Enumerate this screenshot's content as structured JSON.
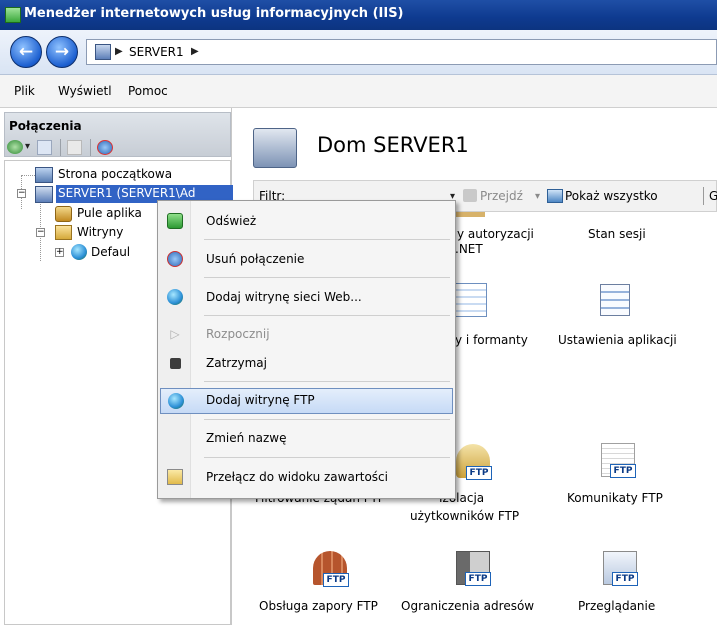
{
  "window": {
    "title": "Menedżer internetowych usług informacyjnych (IIS)"
  },
  "address": {
    "crumb_server": "SERVER1"
  },
  "menu": [
    "Plik",
    "Wyświetl",
    "Pomoc"
  ],
  "connections": {
    "title": "Połączenia",
    "tree": {
      "start_page": "Strona początkowa",
      "server": "SERVER1 (SERVER1\\Ad",
      "app_pools": "Pule aplika",
      "sites": "Witryny",
      "default_site": "Defaul"
    }
  },
  "main": {
    "title": "Dom SERVER1",
    "filter_label": "Filtr:",
    "go_label": "Przejdź",
    "show_all_label": "Pokaż wszystko",
    "group_label": "G",
    "features": {
      "auth_rules": "y autoryzacji",
      "auth_rules_2": ".NET",
      "session_state": "Stan sesji",
      "controls": "y i formanty",
      "app_settings": "Ustawienia aplikacji",
      "ftp_filter": "Filtrowanie żądań FTP",
      "ftp_isolation": "Izolacja",
      "ftp_isolation_2": "użytkowników FTP",
      "ftp_messages": "Komunikaty FTP",
      "ftp_firewall": "Obsługa zapory FTP",
      "ftp_ip": "Ograniczenia adresów",
      "ftp_browse": "Przeglądanie"
    },
    "ftp_badge": "FTP"
  },
  "context_menu": {
    "refresh": "Odśwież",
    "remove_connection": "Usuń połączenie",
    "add_website": "Dodaj witrynę sieci Web...",
    "start": "Rozpocznij",
    "stop": "Zatrzymaj",
    "add_ftp": "Dodaj witrynę FTP",
    "rename": "Zmień nazwę",
    "switch_view": "Przełącz do widoku zawartości"
  }
}
